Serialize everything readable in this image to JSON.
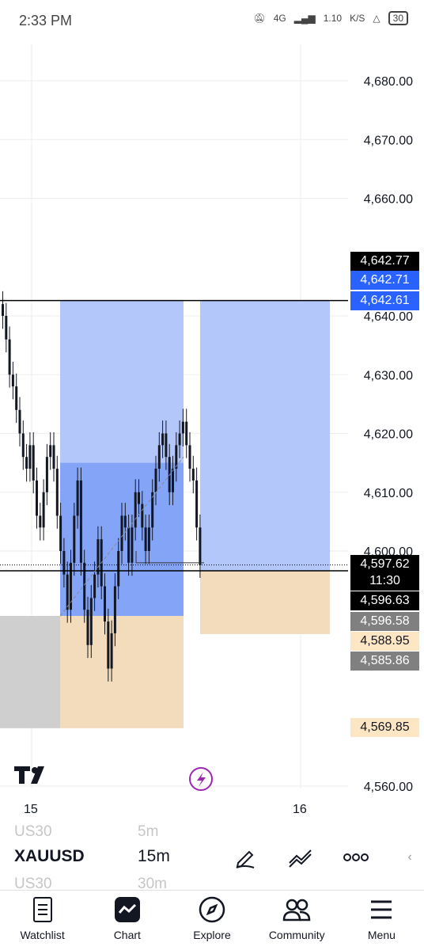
{
  "status": {
    "time": "2:33 PM",
    "network": "4G",
    "speed": "1.10",
    "speed_unit": "K/S",
    "battery": "30"
  },
  "chart": {
    "y_ticks": [
      "4,680.00",
      "4,670.00",
      "4,660.00",
      "4,640.00",
      "4,630.00",
      "4,620.00",
      "4,610.00",
      "4,600.00",
      "4,560.00"
    ],
    "x_ticks": [
      "15",
      "16"
    ],
    "price_tags": [
      {
        "value": "4,642.77",
        "color": "#000000",
        "text": "#ffffff"
      },
      {
        "value": "4,642.71",
        "color": "#2962ff",
        "text": "#ffffff"
      },
      {
        "value": "4,642.61",
        "color": "#2962ff",
        "text": "#ffffff"
      },
      {
        "value": "4,597.62",
        "color": "#000000",
        "text": "#ffffff"
      },
      {
        "value": "11:30",
        "color": "#000000",
        "text": "#ffffff"
      },
      {
        "value": "4,596.63",
        "color": "#000000",
        "text": "#ffffff"
      },
      {
        "value": "4,596.58",
        "color": "#808080",
        "text": "#ffffff"
      },
      {
        "value": "4,588.95",
        "color": "#fde6c4",
        "text": "#131722"
      },
      {
        "value": "4,585.86",
        "color": "#808080",
        "text": "#ffffff"
      },
      {
        "value": "4,569.85",
        "color": "#fde6c4",
        "text": "#131722"
      }
    ],
    "colors": {
      "target_zone": "#b3c7fb",
      "entry_zone": "#7b9ef7",
      "stop_zone": "#f2dcbc",
      "grey_zone": "#cfcfcf",
      "candle": "#131722"
    }
  },
  "chart_data": {
    "type": "candlestick",
    "title": "",
    "symbol": "XAUUSD",
    "interval": "15m",
    "y_labels": [
      "4,680.00",
      "4,670.00",
      "4,660.00",
      "4,640.00",
      "4,630.00",
      "4,620.00",
      "4,610.00",
      "4,600.00",
      "4,560.00"
    ],
    "x_labels": [
      "15",
      "16"
    ],
    "ylim": [
      4557,
      4686
    ],
    "closes": [
      4640,
      4636,
      4630,
      4628,
      4624,
      4620,
      4616,
      4614,
      4618,
      4612,
      4606,
      4604,
      4610,
      4616,
      4618,
      4614,
      4606,
      4600,
      4596,
      4590,
      4598,
      4606,
      4612,
      4598,
      4590,
      4584,
      4592,
      4596,
      4602,
      4594,
      4588,
      4580,
      4586,
      4594,
      4600,
      4606,
      4604,
      4598,
      4604,
      4610,
      4608,
      4604,
      4600,
      4604,
      4610,
      4614,
      4618,
      4620,
      4616,
      4610,
      4614,
      4618,
      4620,
      4622,
      4618,
      4614,
      4612,
      4604,
      4597.62
    ],
    "levels": [
      4642.77,
      4642.71,
      4642.61,
      4597.62,
      4596.63,
      4596.58,
      4588.95,
      4585.86,
      4569.85
    ]
  },
  "ghost": {
    "prev_symbol": "US30",
    "prev_interval": "5m",
    "next_symbol": "US30",
    "next_interval": "30m"
  },
  "toolbar": {
    "symbol": "XAUUSD",
    "interval": "15m"
  },
  "nav": [
    {
      "label": "Watchlist",
      "icon": "watchlist-icon"
    },
    {
      "label": "Chart",
      "icon": "chart-icon"
    },
    {
      "label": "Explore",
      "icon": "compass-icon"
    },
    {
      "label": "Community",
      "icon": "community-icon"
    },
    {
      "label": "Menu",
      "icon": "menu-icon"
    }
  ]
}
